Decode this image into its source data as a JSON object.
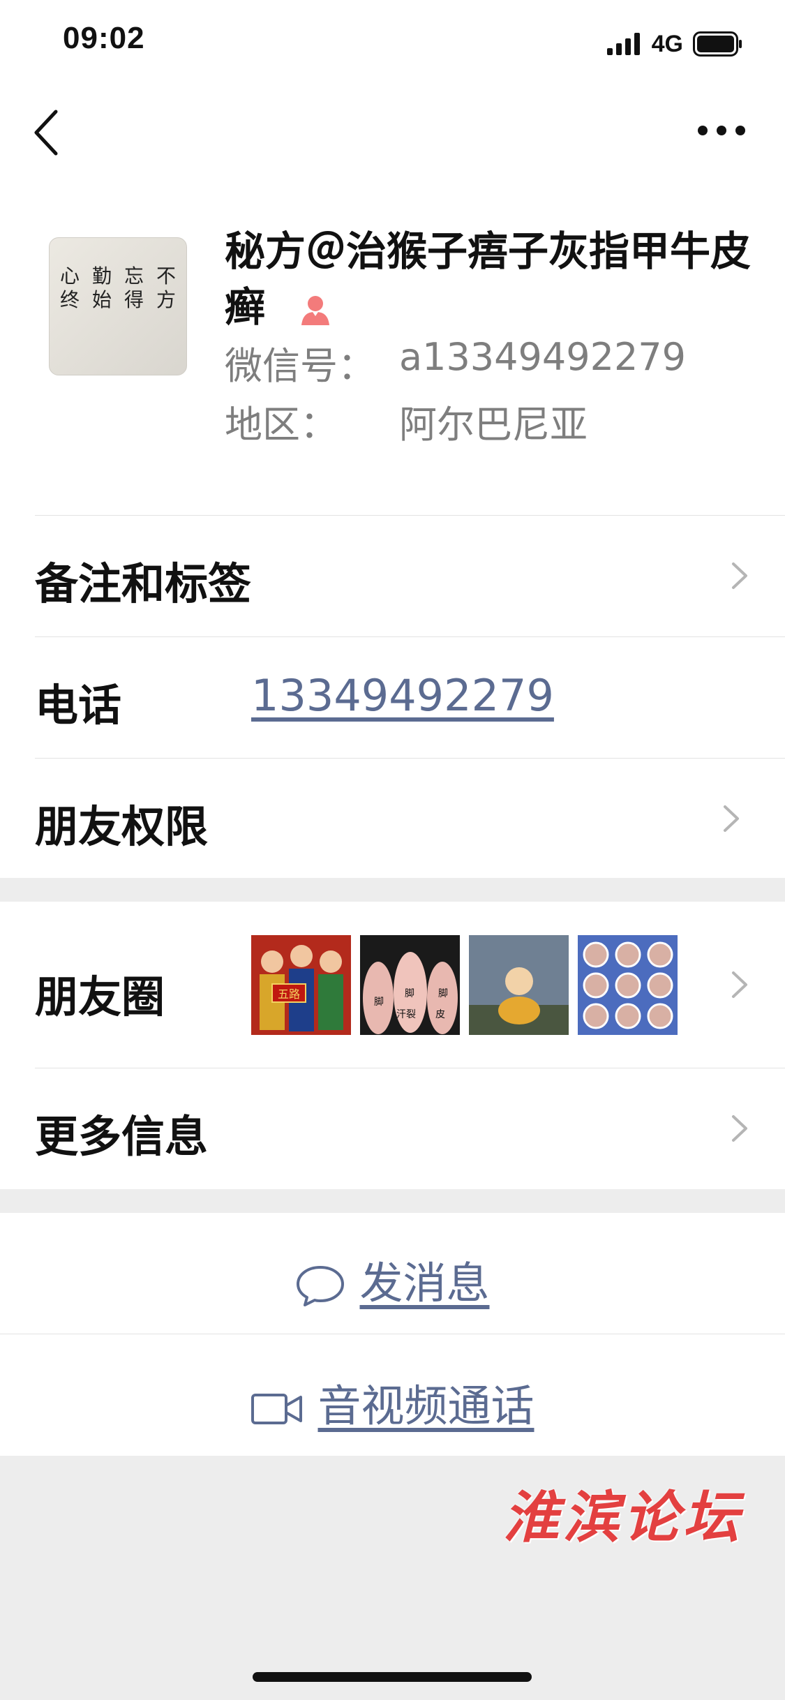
{
  "status_bar": {
    "time": "09:02",
    "network": "4G"
  },
  "profile": {
    "name": "秘方＠治猴子痦子灰指甲牛皮癣",
    "wechat_id_label": "微信号：",
    "wechat_id": "a13349492279",
    "region_label": "地区：",
    "region": "阿尔巴尼亚",
    "avatar_text": [
      "不方",
      "忘得",
      "勤始",
      "心终"
    ]
  },
  "rows": {
    "remarks": "备注和标签",
    "phone_label": "电话",
    "phone_value": "13349492279",
    "friend_permissions": "朋友权限",
    "moments": "朋友圈",
    "more_info": "更多信息"
  },
  "moments_thumbs": [
    {
      "text": "五路财神"
    },
    {
      "text": "脚臭 脚汗裂 脚脱皮"
    },
    {
      "text": ""
    },
    {
      "text": ""
    }
  ],
  "actions": {
    "send_message": "发消息",
    "video_call": "音视频通话"
  },
  "watermark": "淮滨论坛",
  "colors": {
    "link": "#5b6b91",
    "gender_icon": "#f37b7b",
    "watermark": "#e34040"
  }
}
